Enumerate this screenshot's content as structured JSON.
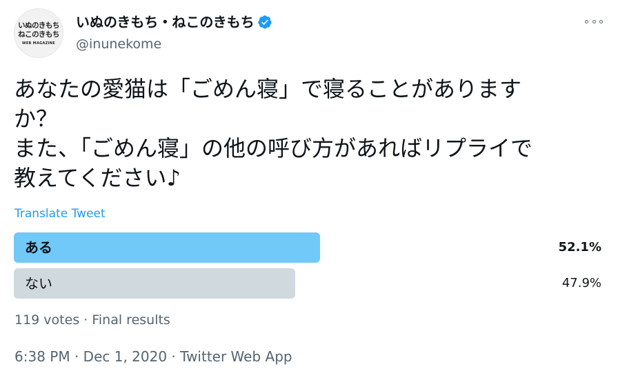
{
  "header": {
    "avatar": {
      "line1": "いぬのきもち",
      "line2": "ねこのきもち",
      "line3": "WEB MAGAZINE"
    },
    "display_name": "いぬのきもち・ねこのきもち",
    "handle": "@inunekome"
  },
  "tweet": {
    "lines": [
      "あなたの愛猫は「ごめん寝」で寝ることがありますか？",
      "また、「ごめん寝」の他の呼び方があればリプライで",
      "教えてください♪"
    ],
    "line1a": "あなたの愛猫は「ごめん寝」で寝ることがあります",
    "line1b": "か？",
    "translate_label": "Translate Tweet"
  },
  "poll": {
    "options": [
      {
        "label": "ある",
        "percent_text": "52.1%",
        "percent": 52.1,
        "winner": true,
        "bar_color": "#71c9f8"
      },
      {
        "label": "ない",
        "percent_text": "47.9%",
        "percent": 47.9,
        "winner": false,
        "bar_color": "#cfd9de"
      }
    ],
    "votes_text": "119 votes",
    "status_text": "Final results"
  },
  "footer": {
    "time": "6:38 PM",
    "date": "Dec 1, 2020",
    "source": "Twitter Web App"
  },
  "colors": {
    "link": "#1d9bf0",
    "verified": "#1d9bf0",
    "secondary_text": "#536471"
  }
}
